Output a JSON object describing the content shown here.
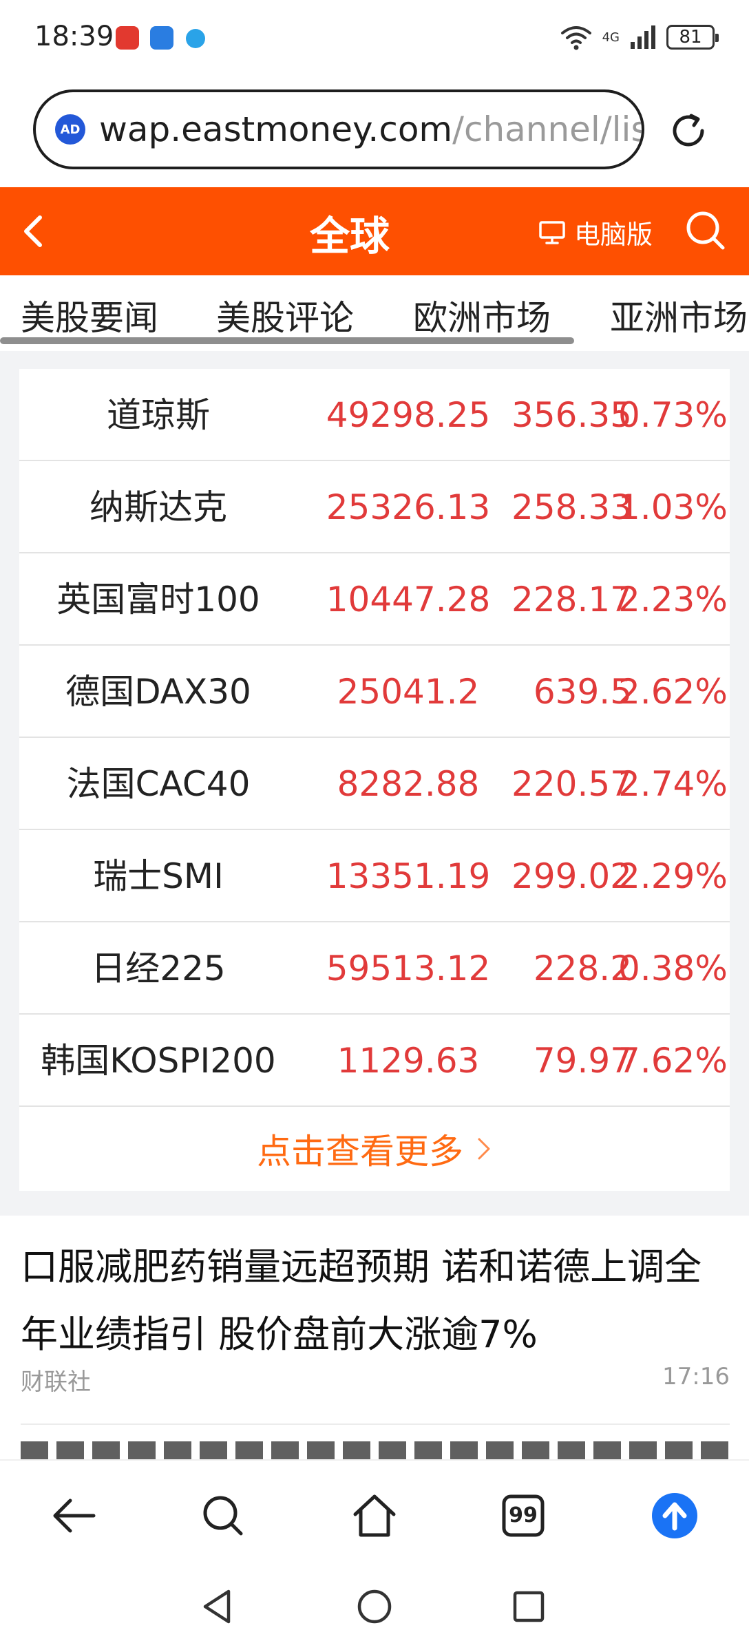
{
  "status_bar": {
    "time": "18:39",
    "network_label": "4G",
    "battery": "81",
    "icons": [
      "wifi-icon",
      "signal-icon",
      "battery-icon"
    ]
  },
  "address_bar": {
    "badge": "AD",
    "domain": "wap.eastmoney.com",
    "path": "/channel/lis"
  },
  "header": {
    "title": "全球",
    "desktop_label": "电脑版",
    "accent_color": "#fe5001"
  },
  "tabs": [
    {
      "label": "美股要闻"
    },
    {
      "label": "美股评论"
    },
    {
      "label": "欧洲市场"
    },
    {
      "label": "亚洲市场"
    }
  ],
  "indices": [
    {
      "name": "道琼斯",
      "price": "49298.25",
      "change": "356.35",
      "pct": "0.73%"
    },
    {
      "name": "纳斯达克",
      "price": "25326.13",
      "change": "258.33",
      "pct": "1.03%"
    },
    {
      "name": "英国富时100",
      "price": "10447.28",
      "change": "228.17",
      "pct": "2.23%"
    },
    {
      "name": "德国DAX30",
      "price": "25041.2",
      "change": "639.5",
      "pct": "2.62%"
    },
    {
      "name": "法国CAC40",
      "price": "8282.88",
      "change": "220.57",
      "pct": "2.74%"
    },
    {
      "name": "瑞士SMI",
      "price": "13351.19",
      "change": "299.02",
      "pct": "2.29%"
    },
    {
      "name": "日经225",
      "price": "59513.12",
      "change": "228.2",
      "pct": "0.38%"
    },
    {
      "name": "韩国KOSPI200",
      "price": "1129.63",
      "change": "79.97",
      "pct": "7.62%"
    }
  ],
  "more_link": "点击查看更多",
  "news": {
    "title": "口服减肥药销量远超预期 诺和诺德上调全年业绩指引 股价盘前大涨逾7%",
    "source": "财联社",
    "time": "17:16"
  },
  "toolbar": {
    "tabs_count": "99",
    "icons": [
      "back-arrow-icon",
      "search-icon",
      "home-icon",
      "tabs-icon",
      "upload-icon"
    ]
  }
}
